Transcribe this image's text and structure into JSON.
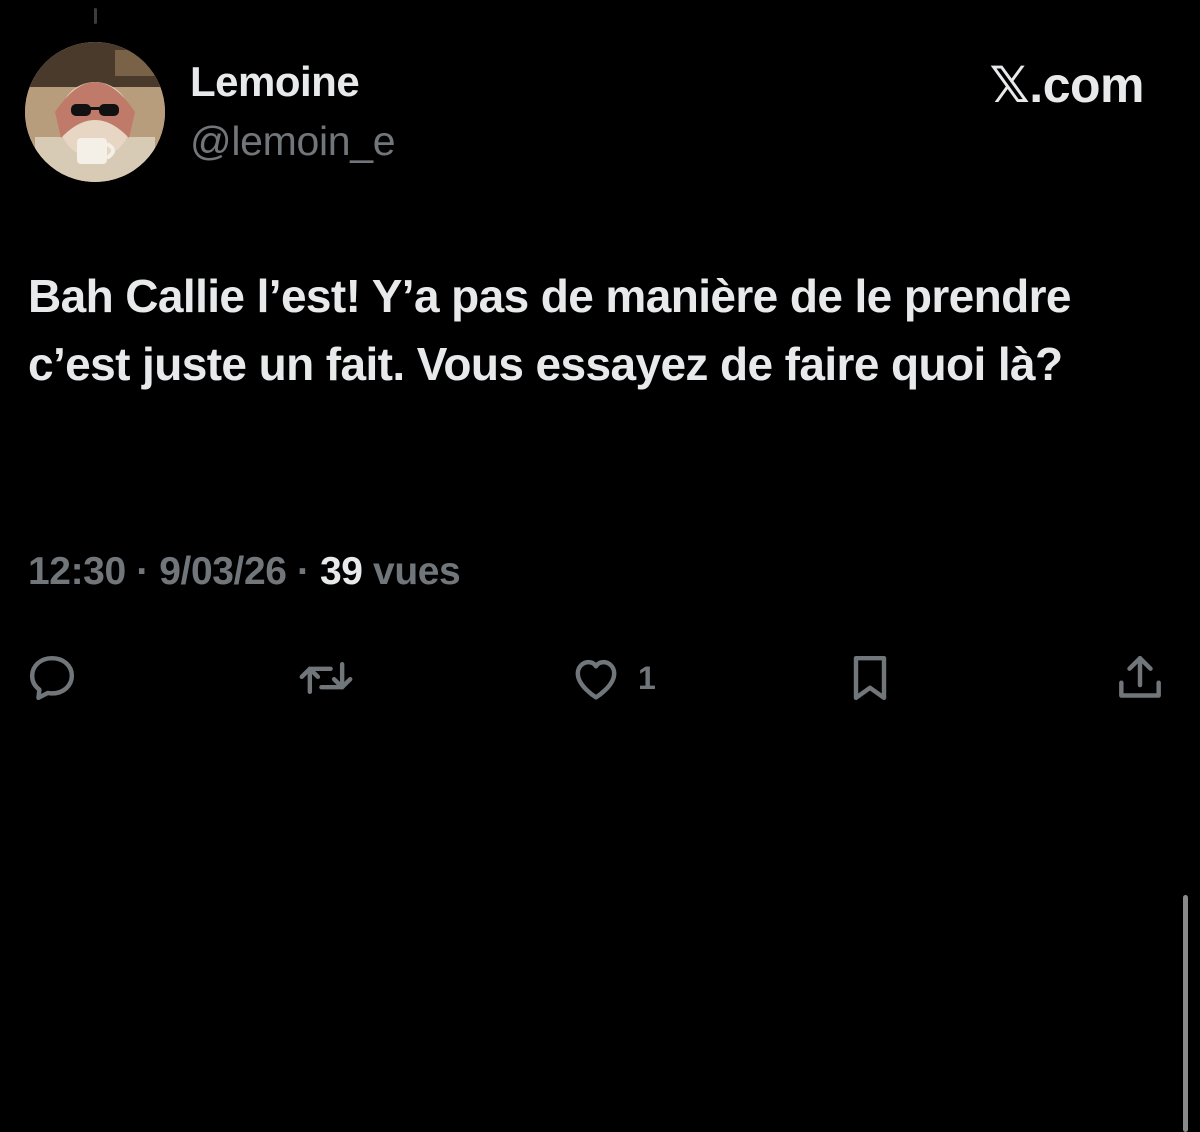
{
  "author": {
    "display_name": "Lemoine",
    "handle": "@lemoin_e"
  },
  "brand": {
    "label": "𝕏.com"
  },
  "tweet": {
    "text": "Bah Callie l’est! Y’a pas de manière de le prendre c’est juste un fait. Vous essayez de faire quoi là?",
    "time": "12:30",
    "separator": "·",
    "date": "9/03/26",
    "views_count": "39",
    "views_label": "vues"
  },
  "actions": {
    "reply_icon": "reply-icon",
    "repost_icon": "repost-icon",
    "like_icon": "heart-icon",
    "like_count": "1",
    "bookmark_icon": "bookmark-icon",
    "share_icon": "share-icon"
  },
  "colors": {
    "background": "#000000",
    "primary_text": "#e7e9ea",
    "secondary_text": "#71767b"
  }
}
